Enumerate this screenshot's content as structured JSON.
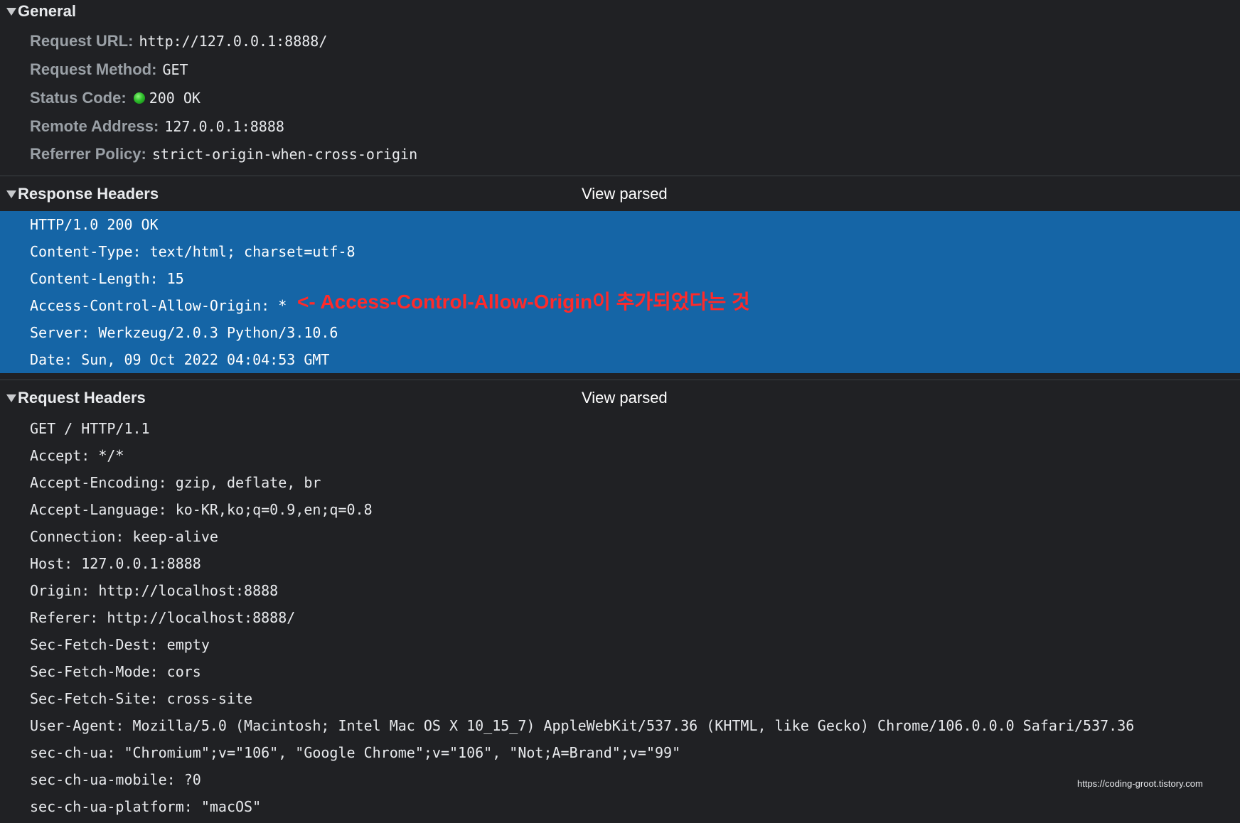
{
  "general": {
    "title": "General",
    "rows": [
      {
        "key": "Request URL:",
        "value": "http://127.0.0.1:8888/"
      },
      {
        "key": "Request Method:",
        "value": "GET"
      },
      {
        "key": "Status Code:",
        "value": "200 OK",
        "status_color": "#2fbf2c"
      },
      {
        "key": "Remote Address:",
        "value": "127.0.0.1:8888"
      },
      {
        "key": "Referrer Policy:",
        "value": "strict-origin-when-cross-origin"
      }
    ]
  },
  "response_headers": {
    "title": "Response Headers",
    "view_parsed_label": "View parsed",
    "highlight_color": "#1565a6",
    "lines": [
      "HTTP/1.0 200 OK",
      "Content-Type: text/html; charset=utf-8",
      "Content-Length: 15",
      "Access-Control-Allow-Origin: *",
      "Server: Werkzeug/2.0.3 Python/3.10.6",
      "Date: Sun, 09 Oct 2022 04:04:53 GMT"
    ]
  },
  "annotation": {
    "text": "<- Access-Control-Allow-Origin이 추가되었다는 것",
    "color": "#ff2a2a"
  },
  "request_headers": {
    "title": "Request Headers",
    "view_parsed_label": "View parsed",
    "lines": [
      "GET / HTTP/1.1",
      "Accept: */*",
      "Accept-Encoding: gzip, deflate, br",
      "Accept-Language: ko-KR,ko;q=0.9,en;q=0.8",
      "Connection: keep-alive",
      "Host: 127.0.0.1:8888",
      "Origin: http://localhost:8888",
      "Referer: http://localhost:8888/",
      "Sec-Fetch-Dest: empty",
      "Sec-Fetch-Mode: cors",
      "Sec-Fetch-Site: cross-site",
      "User-Agent: Mozilla/5.0 (Macintosh; Intel Mac OS X 10_15_7) AppleWebKit/537.36 (KHTML, like Gecko) Chrome/106.0.0.0 Safari/537.36",
      "sec-ch-ua: \"Chromium\";v=\"106\", \"Google Chrome\";v=\"106\", \"Not;A=Brand\";v=\"99\"",
      "sec-ch-ua-mobile: ?0",
      "sec-ch-ua-platform: \"macOS\""
    ]
  },
  "watermark": "https://coding-groot.tistory.com",
  "icons": {
    "section_toggle": "triangle-down-icon",
    "status": "green-status-dot-icon"
  }
}
